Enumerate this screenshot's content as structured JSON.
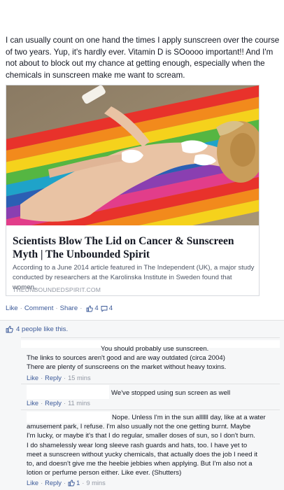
{
  "post": {
    "text": "I can usually count on one hand the times I apply sunscreen over the course of two years. Yup, it's hardly ever. Vitamin D is SOoooo important!! And I'm not about to block out my chance at getting enough, especially when the chemicals in sunscreen make me want to scream."
  },
  "link_card": {
    "title": "Scientists Blow The Lid on Cancer & Sunscreen Myth | The Unbounded Spirit",
    "description": "According to a June 2014 article featured in The Independent (UK), a major study conducted by researchers at the Karolinska Institute in Sweden found that women...",
    "domain": "THEUNBOUNDEDSPIRIT.COM"
  },
  "actions": {
    "like": "Like",
    "comment": "Comment",
    "share": "Share",
    "like_count": "4",
    "comment_count": "4"
  },
  "likes_summary": "4 people like this.",
  "comments": [
    {
      "lines": [
        "You should probably use sunscreen.",
        "The links to sources aren't good and are way outdated (circa 2004)",
        "There are plenty of sunscreens on the market without heavy toxins."
      ],
      "like": "Like",
      "reply": "Reply",
      "time": "15 mins"
    },
    {
      "lines": [
        "We've stopped using sun screen as well"
      ],
      "like": "Like",
      "reply": "Reply",
      "time": "11 mins"
    },
    {
      "lines": [
        "Nope. Unless I'm in the sun allllll day, like at a water",
        "amusement park, I refuse. I'm also usually not the one getting burnt. Maybe",
        "I'm lucky, or maybe it's that I do regular, smaller doses of sun, so I don't burn.",
        "I do shamelessly wear long sleeve rash guards and hats, too. I have yet to",
        "meet a sunscreen without yucky chemicals, that actually does the job I need it",
        "to, and doesn't give me the heebie jebbies when applying. But I'm also not a",
        "lotion or perfume person either. Like ever. (Shutters)"
      ],
      "like": "Like",
      "reply": "Reply",
      "like_count": "1",
      "time": "9 mins"
    }
  ],
  "colors": {
    "link": "#3b5998",
    "meta": "#9197a3",
    "text": "#141823",
    "panel": "#f6f7f8"
  },
  "icons": [
    "thumbs-up-icon",
    "comment-bubble-icon"
  ]
}
